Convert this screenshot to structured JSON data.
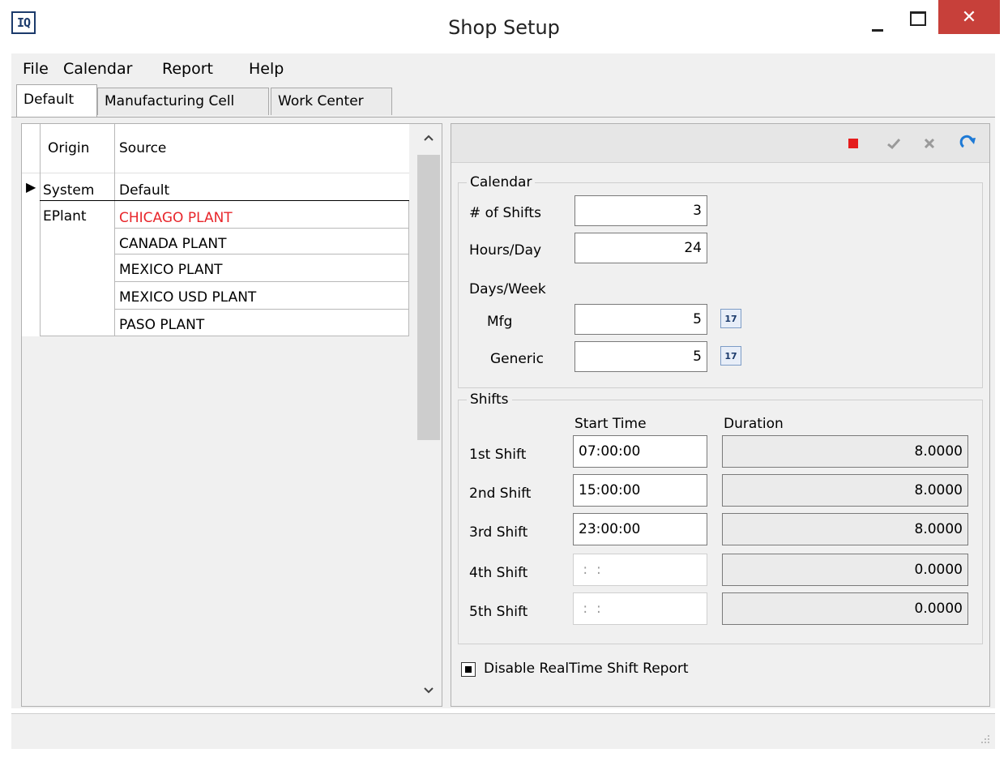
{
  "window": {
    "app_icon": "IQ",
    "title": "Shop Setup",
    "close_glyph": "✕"
  },
  "menu": [
    "File",
    "Calendar",
    "Report",
    "Help"
  ],
  "tabs": [
    "Default",
    "Manufacturing Cell",
    "Work Center"
  ],
  "grid": {
    "columns": [
      "Origin",
      "Source"
    ],
    "rows": [
      {
        "origin": "System",
        "source": "Default",
        "highlight": false
      },
      {
        "origin": "EPlant",
        "source": "CHICAGO PLANT",
        "highlight": true
      },
      {
        "origin": "",
        "source": "CANADA PLANT",
        "highlight": false
      },
      {
        "origin": "",
        "source": "MEXICO PLANT",
        "highlight": false
      },
      {
        "origin": "",
        "source": "MEXICO USD PLANT",
        "highlight": false
      },
      {
        "origin": "",
        "source": "PASO PLANT",
        "highlight": false
      }
    ],
    "current_row_marker": "▶",
    "highlight_color": "#e8262b"
  },
  "toolbar": {
    "icons": [
      "stop-icon",
      "check-icon",
      "cancel-icon",
      "refresh-icon"
    ],
    "stop_color": "#e51c1c"
  },
  "calendar": {
    "legend": "Calendar",
    "shifts_label": "# of Shifts",
    "shifts_value": "3",
    "hours_label": "Hours/Day",
    "hours_value": "24",
    "days_week_label": "Days/Week",
    "mfg_label": "Mfg",
    "mfg_value": "5",
    "generic_label": "Generic",
    "generic_value": "5",
    "calendar_icon_text": "17"
  },
  "shifts": {
    "legend": "Shifts",
    "start_time_header": "Start Time",
    "duration_header": "Duration",
    "rows": [
      {
        "label": "1st Shift",
        "start": "07:00:00",
        "duration": "8.0000",
        "empty": false
      },
      {
        "label": "2nd Shift",
        "start": "15:00:00",
        "duration": "8.0000",
        "empty": false
      },
      {
        "label": "3rd Shift",
        "start": "23:00:00",
        "duration": "8.0000",
        "empty": false
      },
      {
        "label": "4th Shift",
        "start": " :  : ",
        "duration": "0.0000",
        "empty": true
      },
      {
        "label": "5th Shift",
        "start": " :  : ",
        "duration": "0.0000",
        "empty": true
      }
    ]
  },
  "disable_realtime": {
    "label": "Disable RealTime Shift Report",
    "checked": true
  }
}
